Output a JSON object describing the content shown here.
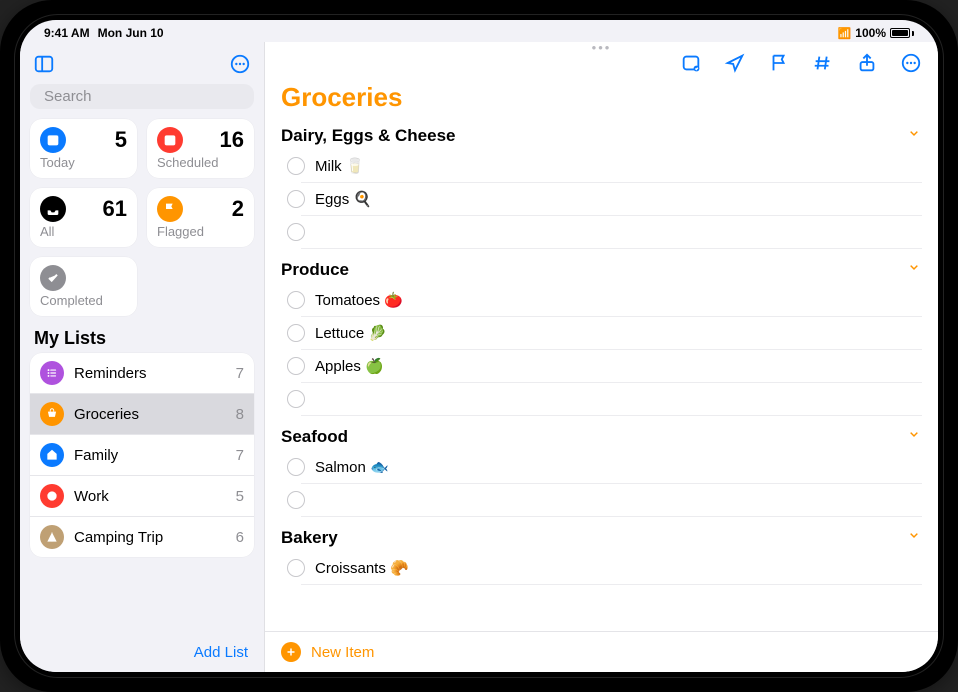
{
  "status": {
    "time": "9:41 AM",
    "date": "Mon Jun 10",
    "battery": "100%"
  },
  "sidebar": {
    "search_placeholder": "Search",
    "tiles": {
      "today": {
        "label": "Today",
        "count": "5",
        "bgcolor": "#0a7aff"
      },
      "scheduled": {
        "label": "Scheduled",
        "count": "16",
        "bgcolor": "#ff3b30"
      },
      "all": {
        "label": "All",
        "count": "61",
        "bgcolor": "#000000"
      },
      "flagged": {
        "label": "Flagged",
        "count": "2",
        "bgcolor": "#ff9500"
      },
      "completed": {
        "label": "Completed",
        "count": "",
        "bgcolor": "#8e8e93"
      }
    },
    "mylists_label": "My Lists",
    "lists": [
      {
        "name": "Reminders",
        "count": "7",
        "color": "#af52de",
        "selected": false
      },
      {
        "name": "Groceries",
        "count": "8",
        "color": "#ff9500",
        "selected": true
      },
      {
        "name": "Family",
        "count": "7",
        "color": "#0a7aff",
        "selected": false
      },
      {
        "name": "Work",
        "count": "5",
        "color": "#ff3b30",
        "selected": false
      },
      {
        "name": "Camping Trip",
        "count": "6",
        "color": "#bfa074",
        "selected": false
      }
    ],
    "add_list_label": "Add List"
  },
  "detail": {
    "title": "Groceries",
    "new_item_label": "New Item",
    "sections": [
      {
        "name": "Dairy, Eggs & Cheese",
        "items": [
          "Milk 🥛",
          "Eggs 🍳",
          ""
        ]
      },
      {
        "name": "Produce",
        "items": [
          "Tomatoes 🍅",
          "Lettuce 🥬",
          "Apples 🍏",
          ""
        ]
      },
      {
        "name": "Seafood",
        "items": [
          "Salmon 🐟",
          ""
        ]
      },
      {
        "name": "Bakery",
        "items": [
          "Croissants 🥐"
        ]
      }
    ]
  }
}
